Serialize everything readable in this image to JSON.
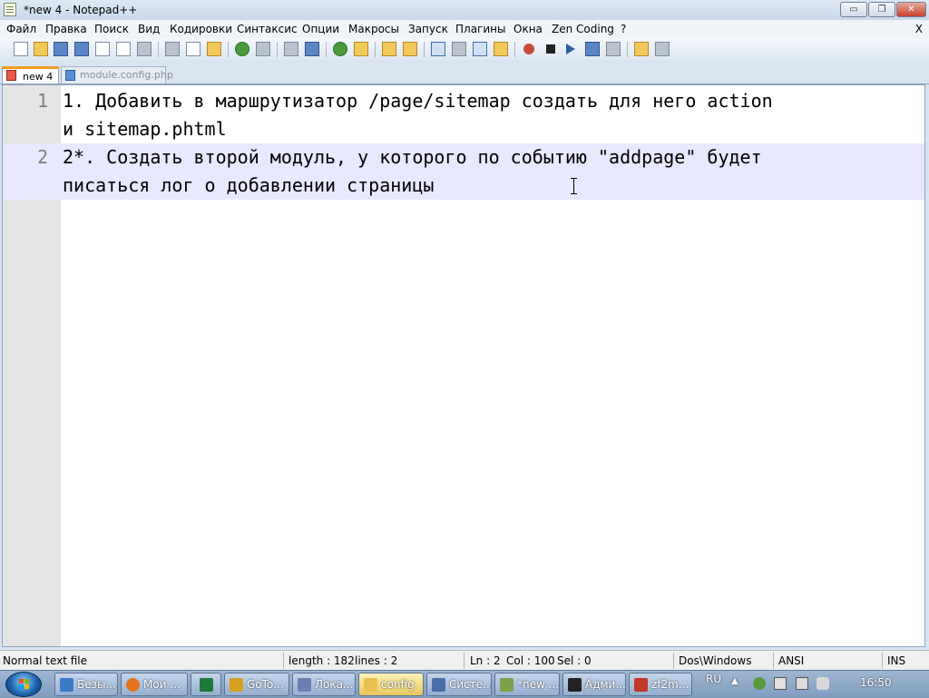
{
  "window": {
    "title": "*new 4 - Notepad++",
    "minimize": "▭",
    "maximize": "❐",
    "close": "✕"
  },
  "menu": {
    "items": [
      "Файл",
      "Правка",
      "Поиск",
      "Вид",
      "Кодировки",
      "Синтаксис",
      "Опции",
      "Макросы",
      "Запуск",
      "Плагины",
      "Окна",
      "Zen Coding",
      "?"
    ],
    "close_doc": "X"
  },
  "toolbar": {
    "icons": [
      "new-file-icon",
      "open-file-icon",
      "save-icon",
      "save-all-icon",
      "close-icon",
      "close-all-icon",
      "print-icon",
      "cut-icon",
      "copy-icon",
      "paste-icon",
      "undo-icon",
      "redo-icon",
      "find-icon",
      "replace-icon",
      "zoom-in-icon",
      "zoom-out-icon",
      "sync-v-icon",
      "sync-h-icon",
      "wrap-icon",
      "all-chars-icon",
      "indent-guide-icon",
      "lang-icon",
      "record-macro-icon",
      "stop-macro-icon",
      "play-macro-icon",
      "run-macro-icon",
      "save-macro-icon",
      "launch-icon",
      "spellcheck-icon"
    ]
  },
  "tabs": [
    {
      "label": "new 4",
      "active": true
    },
    {
      "label": "module.config.php",
      "active": false
    }
  ],
  "editor": {
    "lines": [
      {
        "number": "1",
        "text": "1. Добавить в маршрутизатор /page/sitemap создать для него action\nи sitemap.phtml"
      },
      {
        "number": "2",
        "text": "2*. Создать второй модуль, у которого по событию \"addpage\" будет\nписаться лог о добавлении страницы"
      }
    ],
    "current_line": 2
  },
  "status": {
    "type": "Normal text file",
    "length": "length : 182",
    "lines": "lines : 2",
    "ln": "Ln : 2",
    "col": "Col : 100",
    "sel": "Sel : 0",
    "eol": "Dos\\Windows",
    "encoding": "ANSI",
    "mode": "INS"
  },
  "taskbar": {
    "items": [
      {
        "label": "Безы...",
        "icon": "paint-icon",
        "color": "#3d79c7"
      },
      {
        "label": "Мои ...",
        "icon": "firefox-icon",
        "color": "#e2741c"
      },
      {
        "label": "",
        "icon": "excel-icon",
        "color": "#1d7a3a"
      },
      {
        "label": "GoTo...",
        "icon": "goto-icon",
        "color": "#d8a020"
      },
      {
        "label": "Лока...",
        "icon": "network-icon",
        "color": "#6a7fb0"
      },
      {
        "label": "config",
        "icon": "folder-icon",
        "color": "#e8c050"
      },
      {
        "label": "Систе...",
        "icon": "system-icon",
        "color": "#4a6fa8"
      },
      {
        "label": "*new ...",
        "icon": "notepadpp-icon",
        "color": "#7fa04a"
      },
      {
        "label": "Адми...",
        "icon": "cmd-icon",
        "color": "#222222"
      },
      {
        "label": "zf2m...",
        "icon": "php-icon",
        "color": "#c0392b"
      }
    ],
    "language": "RU",
    "clock": "16:50"
  }
}
